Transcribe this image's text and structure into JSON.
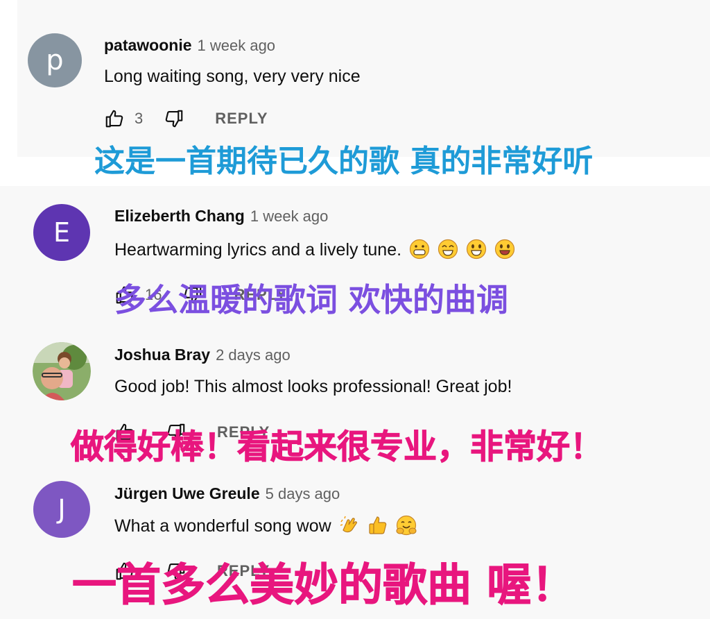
{
  "comments": [
    {
      "avatar_letter": "p",
      "avatar_color": "#8795a1",
      "author": "patawoonie",
      "time": "1 week ago",
      "text": "Long waiting song, very very nice",
      "likes": "3",
      "reply_label": "REPLY",
      "caption": "这是一首期待已久的歌 真的非常好听",
      "caption_color": "#1e9bd7"
    },
    {
      "avatar_letter": "E",
      "avatar_color": "#5e35b1",
      "author": "Elizeberth Chang",
      "time": "1 week ago",
      "text": "Heartwarming lyrics and a lively tune.",
      "emojis": [
        "grinning-face-icon",
        "smiling-eyes-face-icon",
        "big-eyes-smile-icon",
        "smiley-face-icon"
      ],
      "likes": "16",
      "reply_label": "REPLY",
      "caption": "多么温暖的歌词 欢快的曲调",
      "caption_color": "#7b4fe0"
    },
    {
      "avatar_type": "photo",
      "author": "Joshua Bray",
      "time": "2 days ago",
      "text": "Good job! This almost looks professional! Great job!",
      "reply_label": "REPLY",
      "caption": "做得好棒！看起来很专业，非常好！",
      "caption_color": "#e8167e"
    },
    {
      "avatar_letter": "J",
      "avatar_color": "#7e57c2",
      "author": "Jürgen Uwe Greule",
      "time": "5 days ago",
      "text": "What a wonderful song wow",
      "emojis": [
        "clapping-hands-icon",
        "thumbs-up-emoji-icon",
        "hugging-face-icon"
      ],
      "reply_label": "REPLY",
      "caption": "一首多么美妙的歌曲 喔！",
      "caption_color": "#e8167e"
    }
  ]
}
